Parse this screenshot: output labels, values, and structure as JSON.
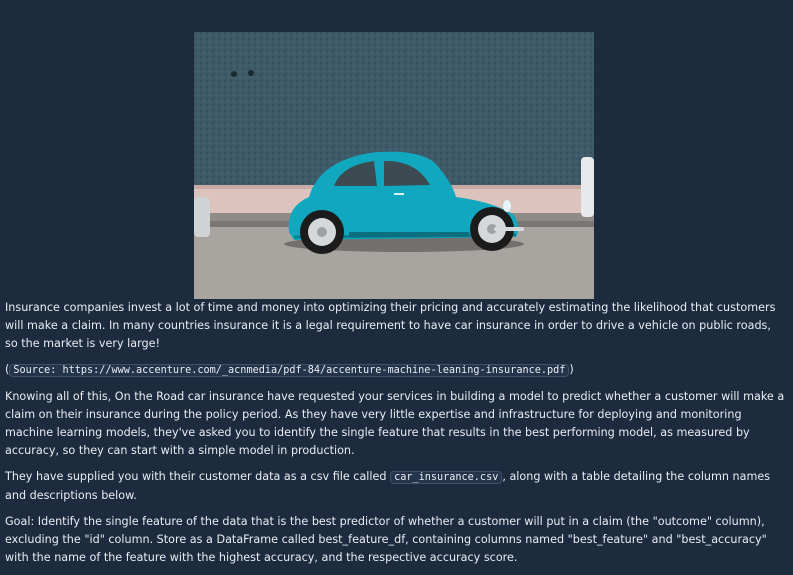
{
  "image": {
    "alt": "turquoise-car-photo"
  },
  "text": {
    "intro": "Insurance companies invest a lot of time and money into optimizing their pricing and accurately estimating the likelihood that customers will make a claim. In many countries insurance it is a legal requirement to have car insurance in order to drive a vehicle on public roads, so the market is very large!",
    "source_open": "(",
    "source_code": "Source: https://www.accenture.com/_acnmedia/pdf-84/accenture-machine-leaning-insurance.pdf",
    "source_close": ")",
    "para2": "Knowing all of this, On the Road car insurance have requested your services in building a model to predict whether a customer will make a claim on their insurance during the policy period. As they have very little expertise and infrastructure for deploying and monitoring machine learning models, they've asked you to identify the single feature that results in the best performing model, as measured by accuracy, so they can start with a simple model in production.",
    "para3_before": "They have supplied you with their customer data as a csv file called ",
    "para3_code": "car_insurance.csv",
    "para3_after": ", along with a table detailing the column names and descriptions below.",
    "goal": "Goal: Identify the single feature of the data that is the best predictor of whether a customer will put in a claim (the \"outcome\" column), excluding the \"id\" column. Store as a DataFrame called best_feature_df, containing columns named \"best_feature\" and \"best_accuracy\" with the name of the feature with the highest accuracy, and the respective accuracy score."
  }
}
